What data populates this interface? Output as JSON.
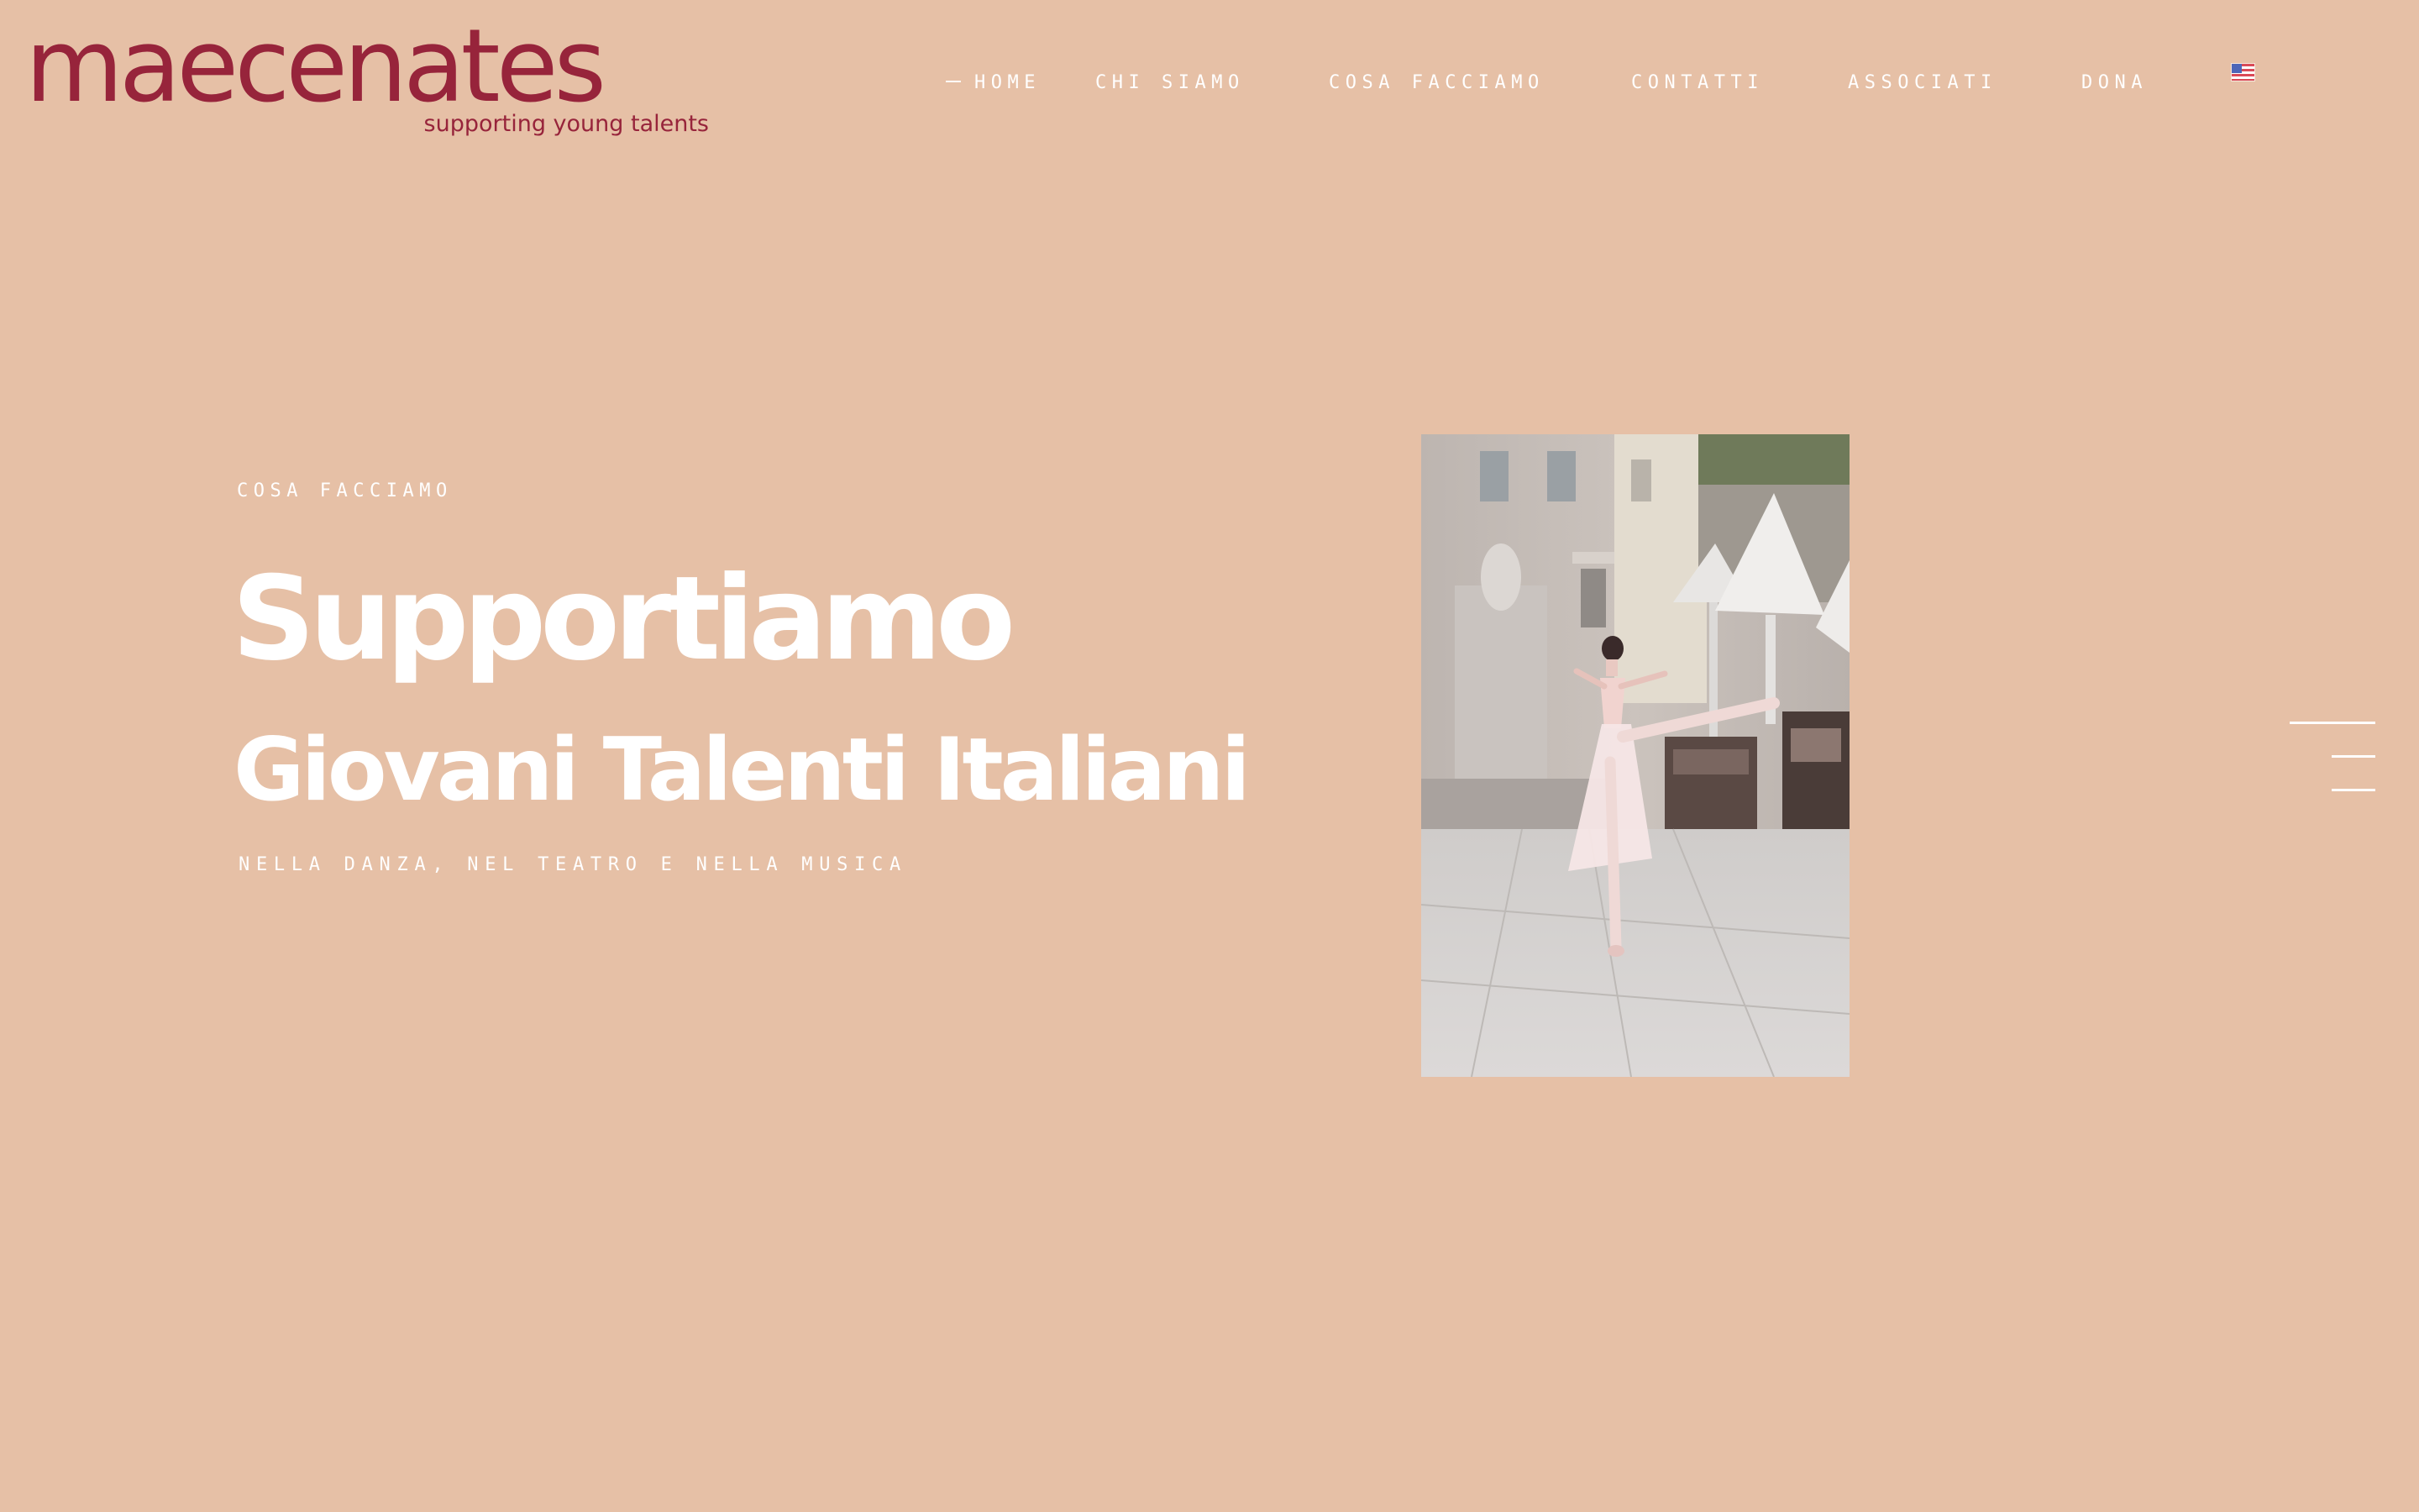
{
  "logo": {
    "word": "maecenates",
    "tagline": "supporting young talents"
  },
  "nav": {
    "items": [
      {
        "label": "HOME",
        "active": true
      },
      {
        "label": "CHI SIAMO",
        "active": false
      },
      {
        "label": "COSA FACCIAMO",
        "active": false
      },
      {
        "label": "CONTATTI",
        "active": false
      },
      {
        "label": "ASSOCIATI",
        "active": false
      },
      {
        "label": "DONA",
        "active": false
      }
    ],
    "language_icon": "us-flag-icon"
  },
  "hero": {
    "eyebrow": "COSA FACCIAMO",
    "headline": "Supportiamo",
    "subheadline": "Giovani Talenti Italiani",
    "tagline": "NELLA DANZA, NEL TEATRO E NELLA MUSICA",
    "image_subject": "ballerina in arabesque on a piazza"
  },
  "menu_icon": "hamburger-menu-icon",
  "colors": {
    "background": "#e6c0a6",
    "brand": "#97243b",
    "text": "#ffffff"
  }
}
